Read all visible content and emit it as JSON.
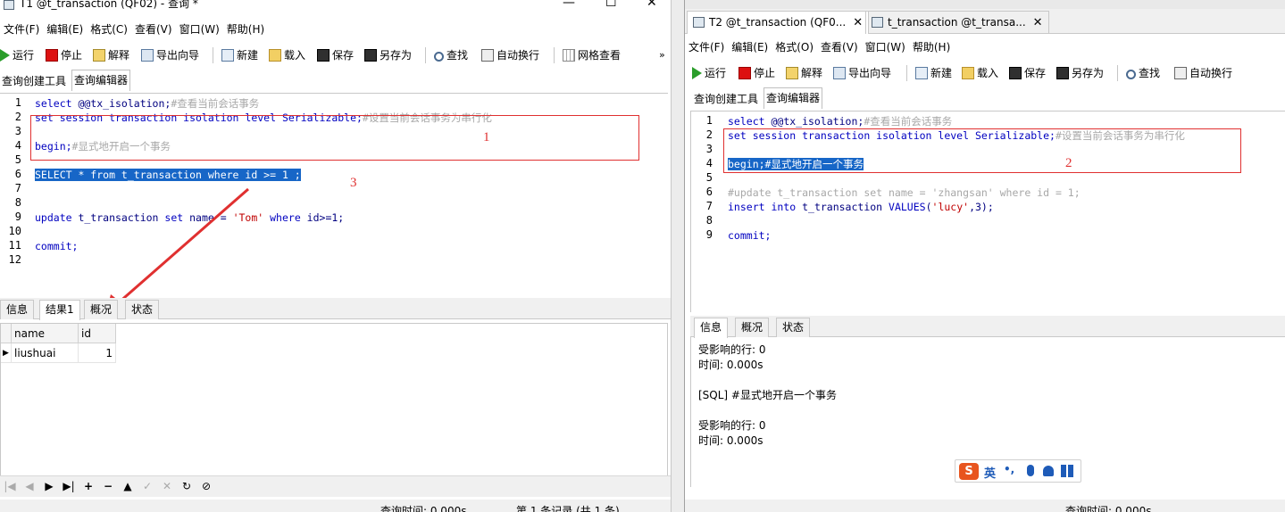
{
  "left": {
    "title": "T1 @t_transaction (QF02) - 查询 *",
    "win_minimize": "—",
    "win_maximize": "☐",
    "win_close": "✕",
    "menu": [
      "文件(F)",
      "编辑(E)",
      "格式(C)",
      "查看(V)",
      "窗口(W)",
      "帮助(H)"
    ],
    "toolbar": [
      "运行",
      "停止",
      "解释",
      "导出向导",
      "新建",
      "载入",
      "保存",
      "另存为",
      "查找",
      "自动换行",
      "网格查看"
    ],
    "overflow": "»",
    "editor_tabs": [
      "查询创建工具",
      "查询编辑器"
    ],
    "line_numbers": [
      "1",
      "2",
      "3",
      "4",
      "5",
      "6",
      "7",
      "8",
      "9",
      "10",
      "11",
      "12"
    ],
    "code": {
      "l1_kw": "select",
      "l1_text": " @@tx_isolation;",
      "l1_cm": "#查看当前会话事务",
      "l2_kw": "set session transaction isolation level Serializable;",
      "l2_cm": "#设置当前会话事务为串行化",
      "l4_kw": "begin;",
      "l4_cm": "#显式地开启一个事务",
      "l6_sel": "SELECT * from t_transaction where id >= 1 ;",
      "l9_a": "update",
      "l9_b": " t_transaction ",
      "l9_c": "set",
      "l9_d": " name = ",
      "l9_e": "'Tom'",
      "l9_f": " where",
      "l9_g": " id>=1;",
      "l11": "commit;"
    },
    "annotations": {
      "box1": "1",
      "sel3": "3"
    },
    "result_tabs": [
      "信息",
      "结果1",
      "概况",
      "状态"
    ],
    "grid": {
      "columns": [
        "name",
        "id"
      ],
      "rows": [
        {
          "name": "liushuai",
          "id": "1"
        }
      ]
    },
    "nav": [
      "|◀",
      "◀",
      "▶",
      "▶|",
      "+",
      "−",
      "▲",
      "✓",
      "✕",
      "↻",
      "⊘"
    ],
    "status": {
      "query_time": "查询时间: 0.000s",
      "records": "第 1 条记录 (共 1 条)"
    }
  },
  "right": {
    "doc_tabs": [
      {
        "label": "T2 @t_transaction (QF0...",
        "close": "✕"
      },
      {
        "label": "t_transaction @t_transa...",
        "close": "✕"
      }
    ],
    "menu": [
      "文件(F)",
      "编辑(E)",
      "格式(O)",
      "查看(V)",
      "窗口(W)",
      "帮助(H)"
    ],
    "toolbar": [
      "运行",
      "停止",
      "解释",
      "导出向导",
      "新建",
      "载入",
      "保存",
      "另存为",
      "查找",
      "自动换行"
    ],
    "editor_tabs": [
      "查询创建工具",
      "查询编辑器"
    ],
    "line_numbers": [
      "1",
      "2",
      "3",
      "4",
      "5",
      "6",
      "7",
      "8",
      "9"
    ],
    "code": {
      "l1_kw": "select",
      "l1_text": " @@tx_isolation;",
      "l1_cm": "#查看当前会话事务",
      "l2_kw": "set session transaction isolation level Serializable;",
      "l2_cm": "#设置当前会话事务为串行化",
      "l4_sel": "begin;#显式地开启一个事务",
      "l6_cm": "#update t_transaction set name = 'zhangsan' where id = 1;",
      "l7_a": "insert into",
      "l7_b": " t_transaction ",
      "l7_c": "VALUES",
      "l7_d": "(",
      "l7_e": "'lucy'",
      "l7_f": ",3);",
      "l9": "commit;"
    },
    "annotations": {
      "box2": "2"
    },
    "result_tabs": [
      "信息",
      "概况",
      "状态"
    ],
    "messages": [
      "受影响的行: 0",
      "时间: 0.000s",
      "",
      "[SQL] #显式地开启一个事务",
      "",
      "受影响的行: 0",
      "时间: 0.000s"
    ],
    "ime": {
      "logo": "S",
      "lang": "英",
      "punct": "•,"
    },
    "status": {
      "query_time": "查询时间: 0.000s"
    }
  },
  "colors": {
    "selection": "#1766c7",
    "annotation": "#e03030",
    "keyword": "#0000c0",
    "comment": "#a8a8a8",
    "string": "#c00000"
  }
}
